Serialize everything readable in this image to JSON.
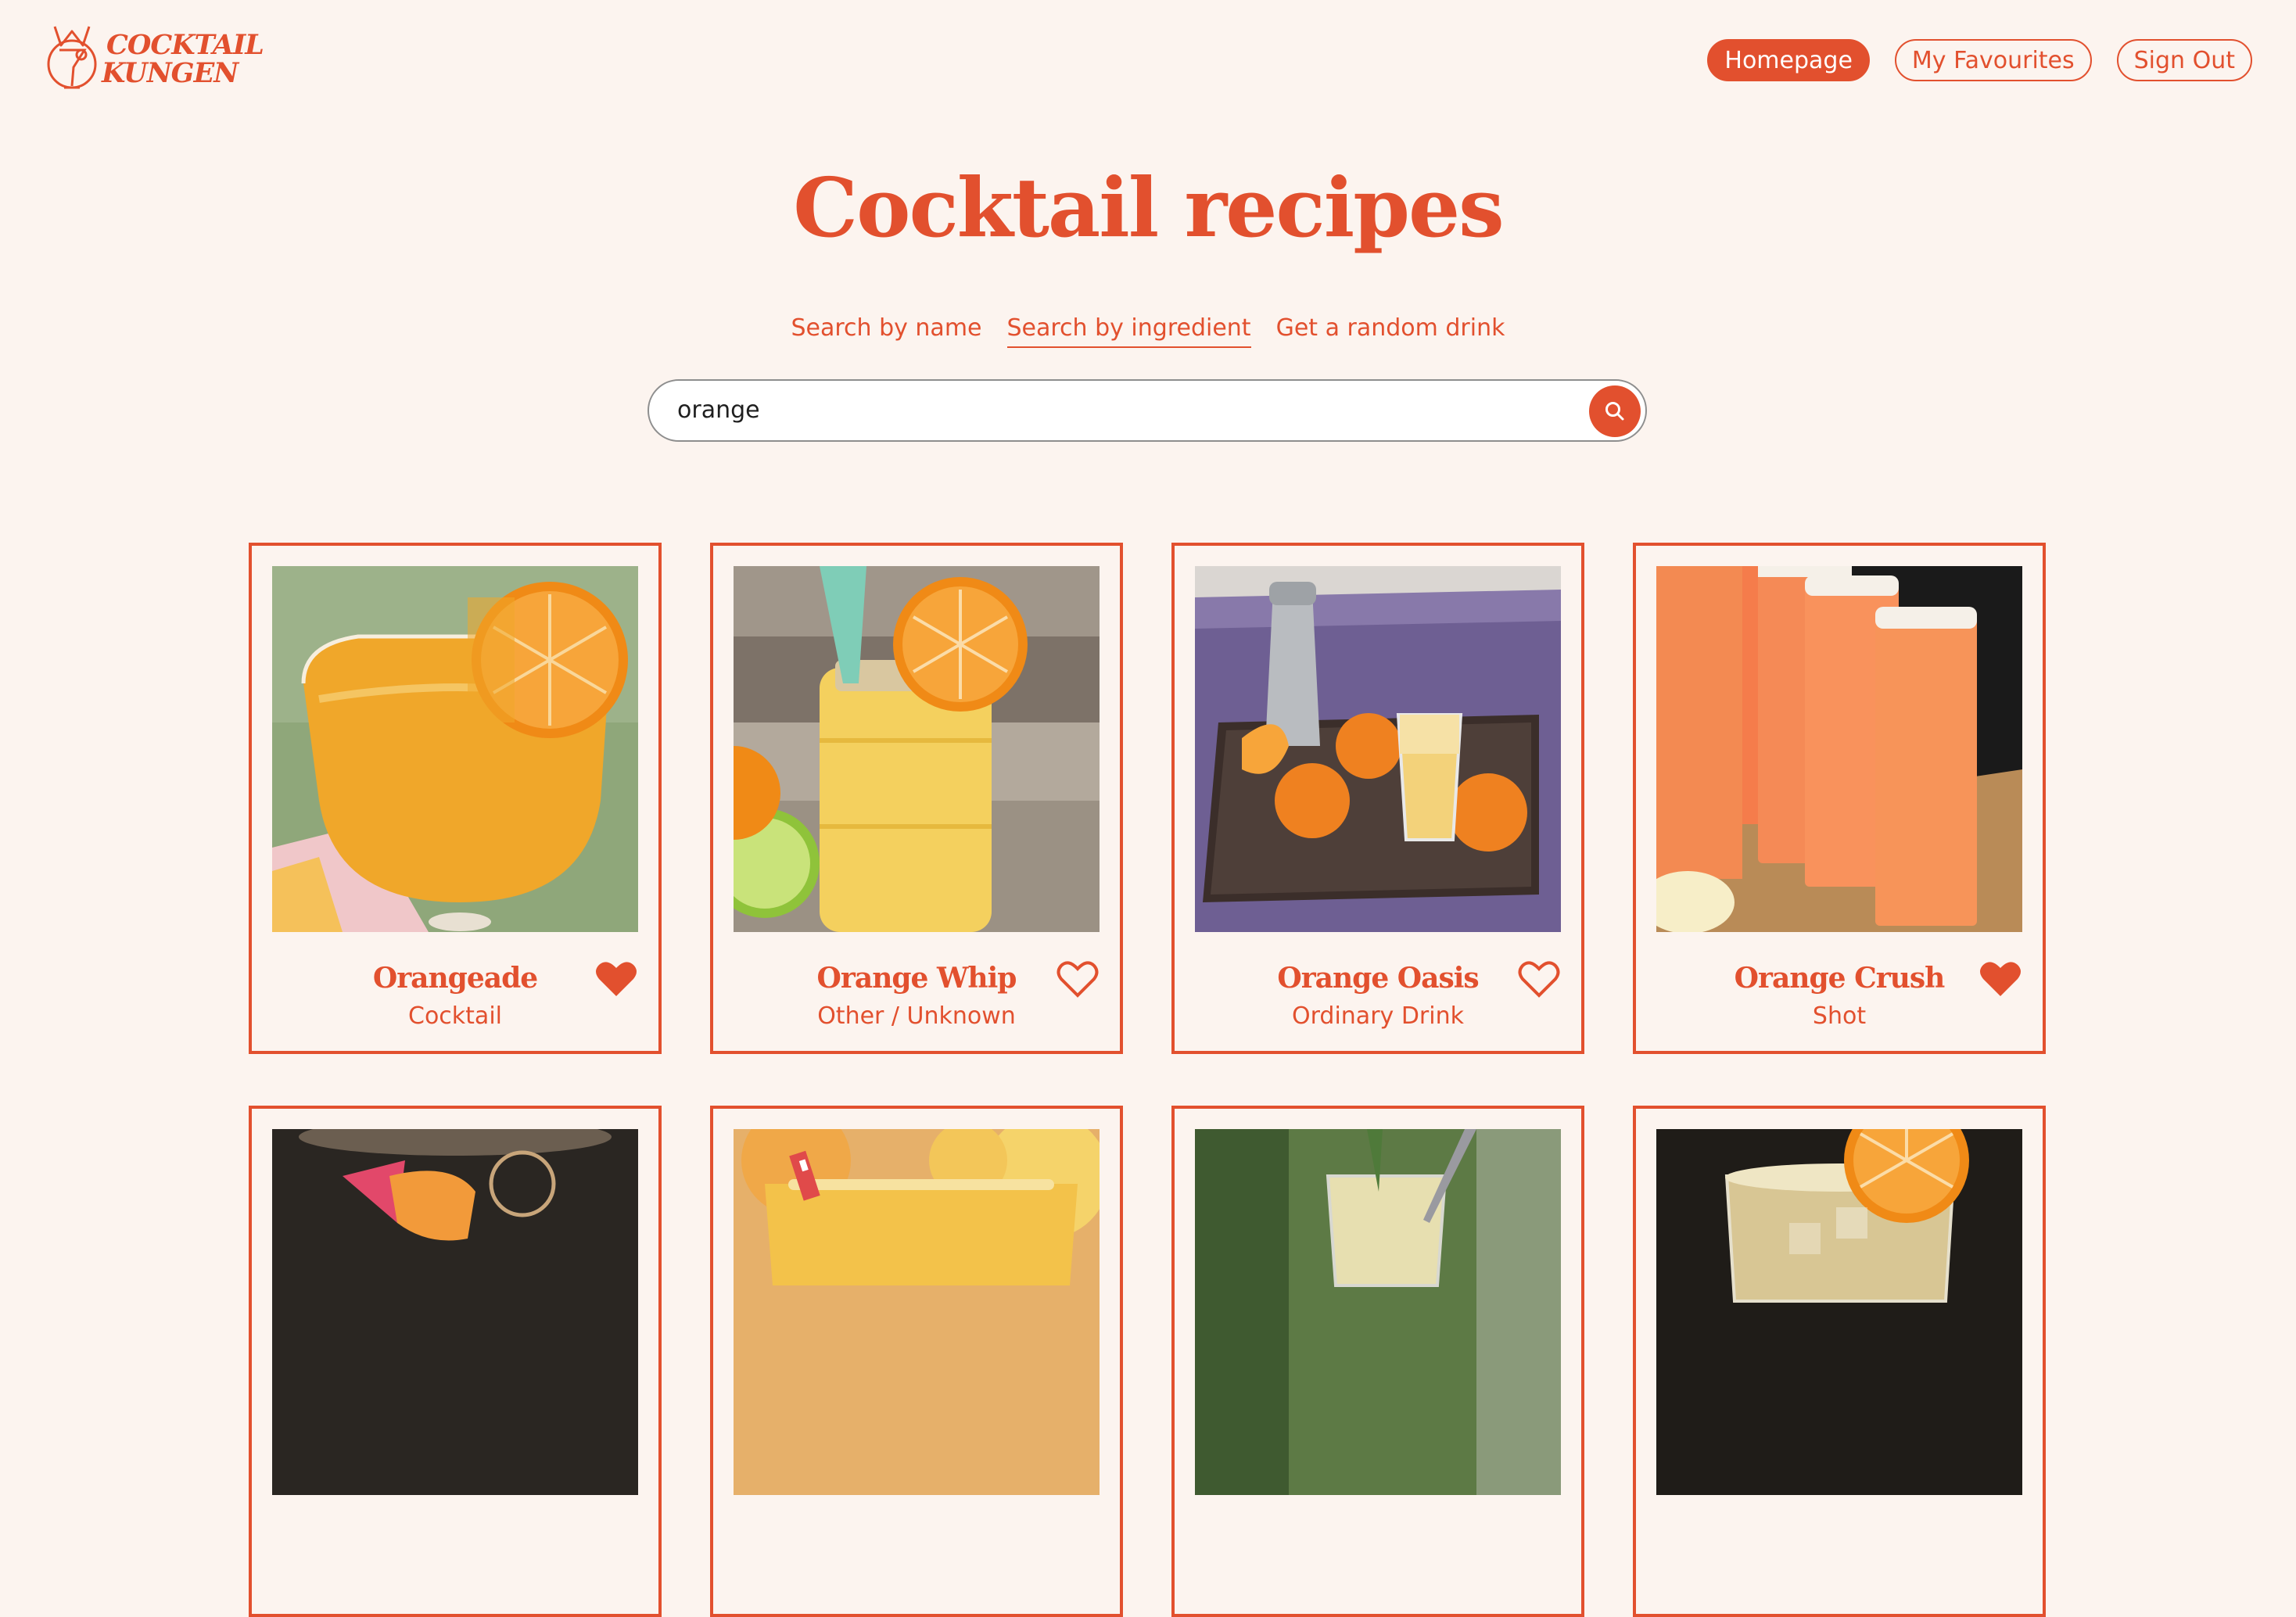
{
  "app": {
    "logo_line1": "COCKTAIL",
    "logo_line2": "KUNGEN"
  },
  "nav": {
    "homepage": "Homepage",
    "favourites": "My Favourites",
    "signout": "Sign Out"
  },
  "title": "Cocktail recipes",
  "tabs": {
    "by_name": "Search by name",
    "by_ingredient": "Search by ingredient",
    "random": "Get a random drink"
  },
  "search": {
    "value": "orange"
  },
  "drinks": [
    {
      "name": "Orangeade",
      "category": "Cocktail",
      "favourite": true
    },
    {
      "name": "Orange Whip",
      "category": "Other / Unknown",
      "favourite": false
    },
    {
      "name": "Orange Oasis",
      "category": "Ordinary Drink",
      "favourite": false
    },
    {
      "name": "Orange Crush",
      "category": "Shot",
      "favourite": true
    },
    {
      "name": "",
      "category": "",
      "favourite": false
    },
    {
      "name": "",
      "category": "",
      "favourite": false
    },
    {
      "name": "",
      "category": "",
      "favourite": false
    },
    {
      "name": "",
      "category": "",
      "favourite": false
    }
  ],
  "colors": {
    "accent": "#e2502e",
    "background": "#fcf4ef"
  },
  "icons": {
    "search": "search-icon",
    "favourite_filled": "heart-filled-icon",
    "favourite_outline": "heart-outline-icon"
  }
}
